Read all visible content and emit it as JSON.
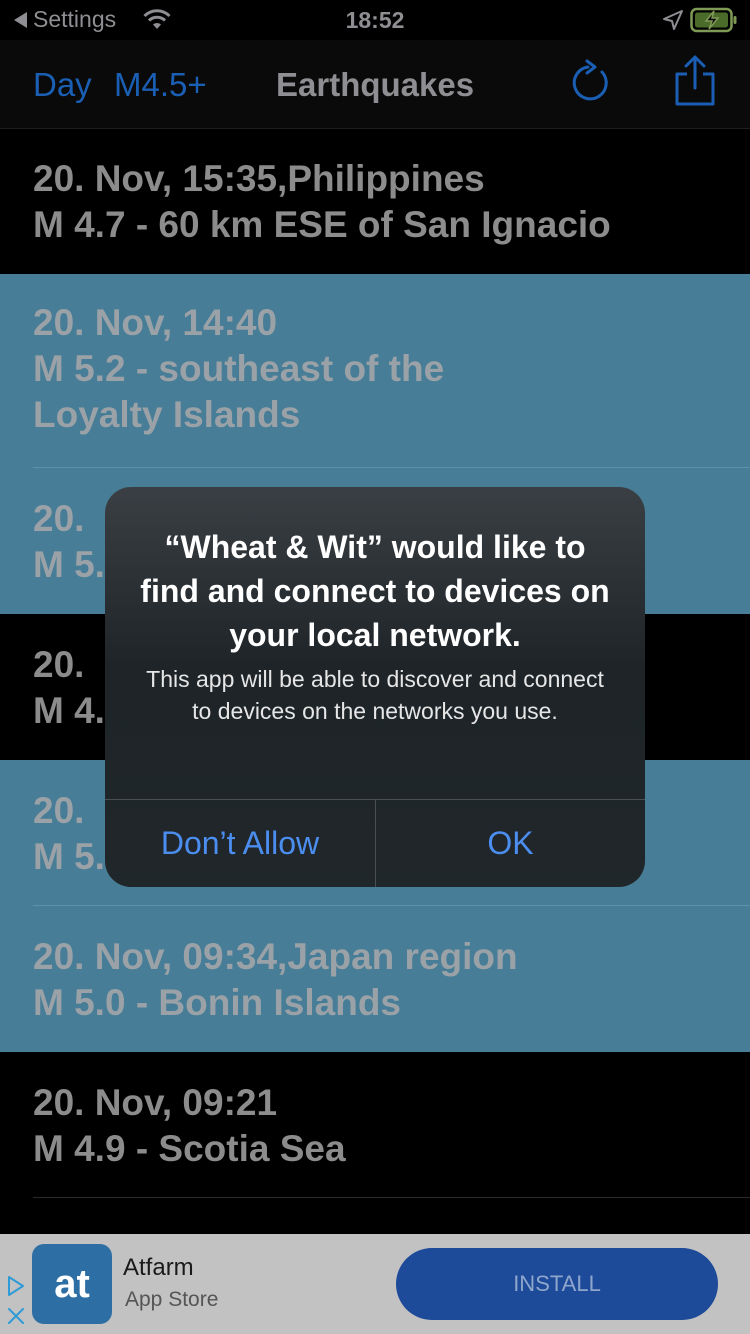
{
  "status_bar": {
    "back_label": "Settings",
    "time": "18:52"
  },
  "nav": {
    "day_label": "Day",
    "magnitude_label": "M4.5+",
    "title": "Earthquakes"
  },
  "quakes": [
    {
      "line1": "20. Nov, 15:35,Philippines",
      "line2": "M 4.7 - 60 km ESE of San Ignacio",
      "line3": ""
    },
    {
      "line1": "20. Nov, 14:40",
      "line2": "M 5.2 - southeast of the",
      "line3": "Loyalty Islands"
    },
    {
      "line1": "20. ",
      "line2": "M 5.",
      "line3": ""
    },
    {
      "line1": "20. ",
      "line2": "M 4.",
      "line3": ""
    },
    {
      "line1": "20. ",
      "line2": "M 5.",
      "line3": ""
    },
    {
      "line1": "20. Nov, 09:34,Japan region",
      "line2": "M 5.0 - Bonin Islands",
      "line3": ""
    },
    {
      "line1": "20. Nov, 09:21",
      "line2": "M 4.9 - Scotia Sea",
      "line3": ""
    }
  ],
  "alert": {
    "title": "“Wheat & Wit” would like to find and connect to devices on your local network.",
    "message": "This app will be able to discover and connect to devices on the networks you use.",
    "deny_label": "Don’t Allow",
    "ok_label": "OK"
  },
  "ad": {
    "logo_text": "at",
    "app_name": "Atfarm",
    "store_label": "App Store",
    "install_label": "INSTALL"
  },
  "colors": {
    "accent": "#1a5fb4",
    "alert_button": "#4b8ef0",
    "row_highlight": "#477d96"
  }
}
